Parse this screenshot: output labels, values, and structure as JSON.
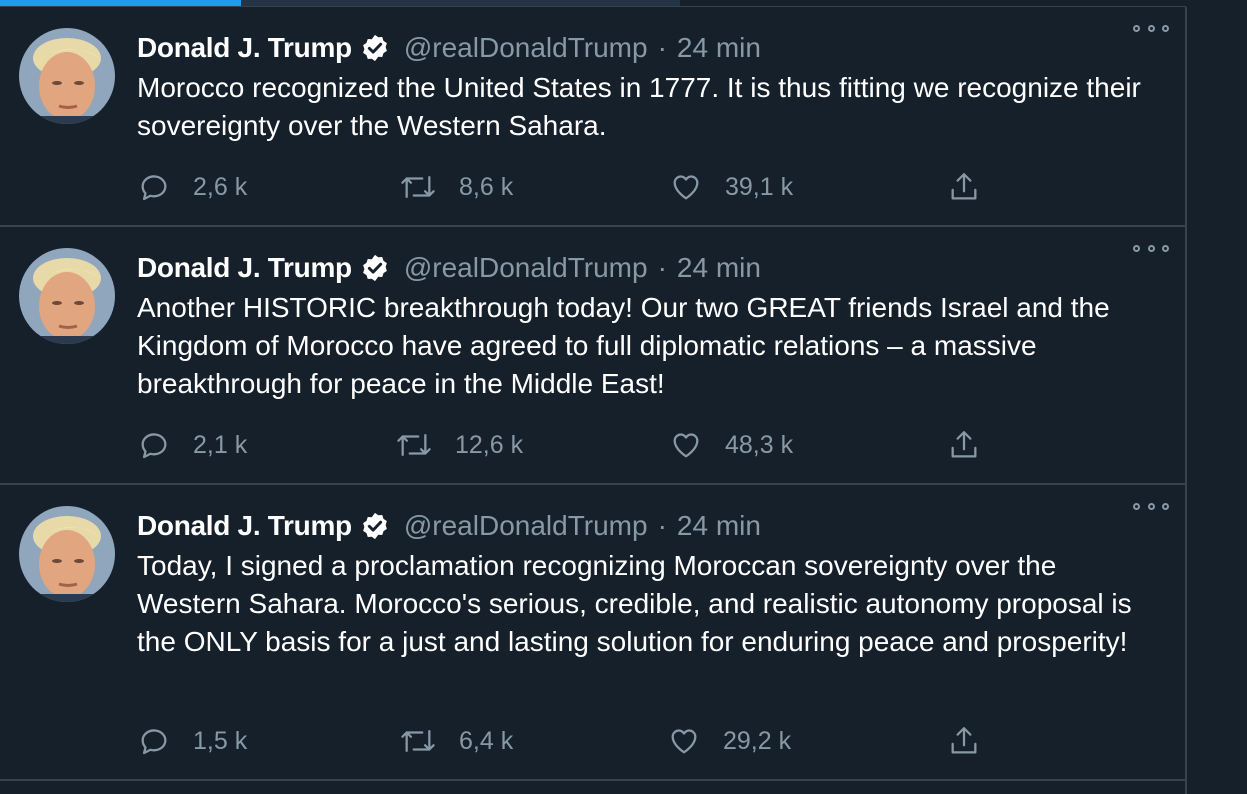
{
  "progress": {
    "fraction": 0.355
  },
  "colors": {
    "background": "#15202b",
    "text": "#ffffff",
    "secondary": "#8899a6",
    "divider": "#38444d",
    "accent": "#1d9bf0"
  },
  "tweets": [
    {
      "name": "Donald J. Trump",
      "handle": "@realDonaldTrump",
      "separator": "·",
      "time": "24 min",
      "text": "Morocco recognized the United States in 1777.  It is thus fitting we recognize their sovereignty over the Western Sahara.",
      "replies": "2,6 k",
      "retweets": "8,6 k",
      "likes": "39,1 k"
    },
    {
      "name": "Donald J. Trump",
      "handle": "@realDonaldTrump",
      "separator": "·",
      "time": "24 min",
      "text": "Another HISTORIC breakthrough today! Our two GREAT friends Israel and the Kingdom of Morocco have agreed to full diplomatic relations – a massive breakthrough for peace in the Middle East!",
      "replies": "2,1 k",
      "retweets": "12,6 k",
      "likes": "48,3 k"
    },
    {
      "name": "Donald J. Trump",
      "handle": "@realDonaldTrump",
      "separator": "·",
      "time": "24 min",
      "text": "Today, I signed a proclamation recognizing Moroccan sovereignty over the Western Sahara.  Morocco's serious, credible, and realistic autonomy proposal is the ONLY basis for a just and lasting solution for enduring peace and prosperity!",
      "replies": "1,5 k",
      "retweets": "6,4 k",
      "likes": "29,2 k"
    }
  ],
  "icons": {
    "avatar": "avatar-portrait",
    "verified": "verified-badge-icon",
    "more": "more-options-icon",
    "reply": "reply-icon",
    "retweet": "retweet-icon",
    "like": "heart-icon",
    "share": "share-icon"
  }
}
